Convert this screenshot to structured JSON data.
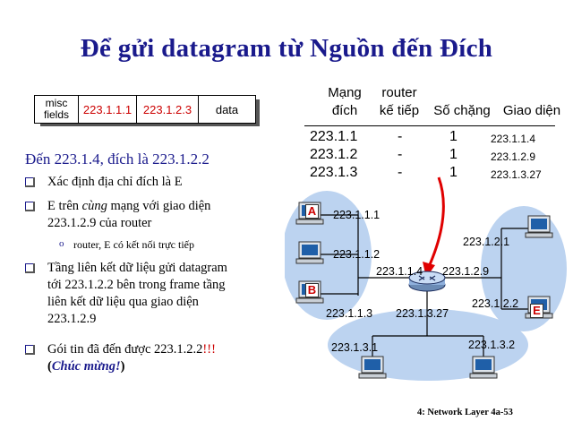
{
  "title": "Để gửi datagram từ Nguồn đến Đích",
  "datagram": {
    "misc_line1": "misc",
    "misc_line2": "fields",
    "source": "223.1.1.1",
    "dest": "223.1.2.3",
    "data": "data"
  },
  "heading": "Đến 223.1.4, đích là 223.1.2.2",
  "bullets": [
    {
      "line1": "Xác định địa chỉ đích là E"
    },
    {
      "line1_a": "E trên ",
      "line1_em": "cùng",
      "line1_b": " mạng với giao diện",
      "line2": "223.1.2.9 của router"
    },
    {
      "line1": "Tầng liên kết dữ liệu gửi datagram",
      "line2": "tới 223.1.2.2 bên trong frame tầng",
      "line3": "liên kết dữ liệu  qua giao diện",
      "line4": "223.1.2.9"
    },
    {
      "line1_a": "Gói tin đã đến được 223.1.2.2",
      "line1_ex": "!!!",
      "line2_open": "(",
      "line2_em": "Chúc mừng!",
      "line2_close": ")"
    }
  ],
  "sub_bullet": "router, E có kết nối trực tiếp",
  "table": {
    "headers": {
      "net_1": "Mạng",
      "net_2": "đích",
      "router_1": "router",
      "router_2": "kế tiếp",
      "hops": "Số chặng",
      "iface": "Giao diện"
    },
    "rows": [
      {
        "net": "223.1.1",
        "router": "-",
        "hops": "1",
        "iface": "223.1.1.4"
      },
      {
        "net": "223.1.2",
        "router": "-",
        "hops": "1",
        "iface": "223.1.2.9"
      },
      {
        "net": "223.1.3",
        "router": "-",
        "hops": "1",
        "iface": "223.1.3.27"
      }
    ]
  },
  "network": {
    "host_letters": {
      "a": "A",
      "b": "B",
      "e": "E"
    },
    "labels": {
      "h1": "223.1.1.1",
      "h2": "223.1.1.2",
      "h3": "223.1.1.3",
      "r1": "223.1.1.4",
      "r2": "223.1.2.9",
      "r3": "223.1.3.27",
      "e1": "223.1.2.1",
      "e2": "223.1.2.2",
      "n1": "223.1.3.1",
      "n2": "223.1.3.2"
    }
  },
  "footer": "4: Network Layer   4a-53",
  "colors": {
    "title": "#1a1a8c",
    "highlight": "#cc0000",
    "network_bg": "#bcd3f0"
  }
}
